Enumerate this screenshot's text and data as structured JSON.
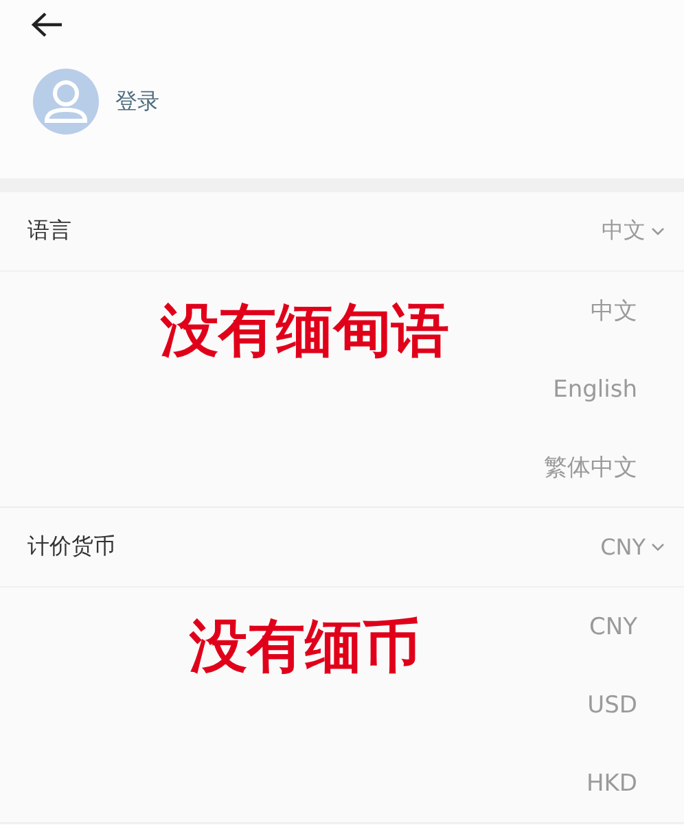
{
  "header": {
    "login_label": "登录"
  },
  "settings": [
    {
      "label": "语言",
      "value": "中文",
      "expanded": true,
      "options": [
        {
          "label": "中文"
        },
        {
          "label": "English"
        },
        {
          "label": "繁体中文"
        }
      ],
      "annotation": "没有缅甸语"
    },
    {
      "label": "计价货币",
      "value": "CNY",
      "expanded": true,
      "options": [
        {
          "label": "CNY"
        },
        {
          "label": "USD"
        },
        {
          "label": "HKD"
        }
      ],
      "annotation": "没有缅币"
    }
  ]
}
